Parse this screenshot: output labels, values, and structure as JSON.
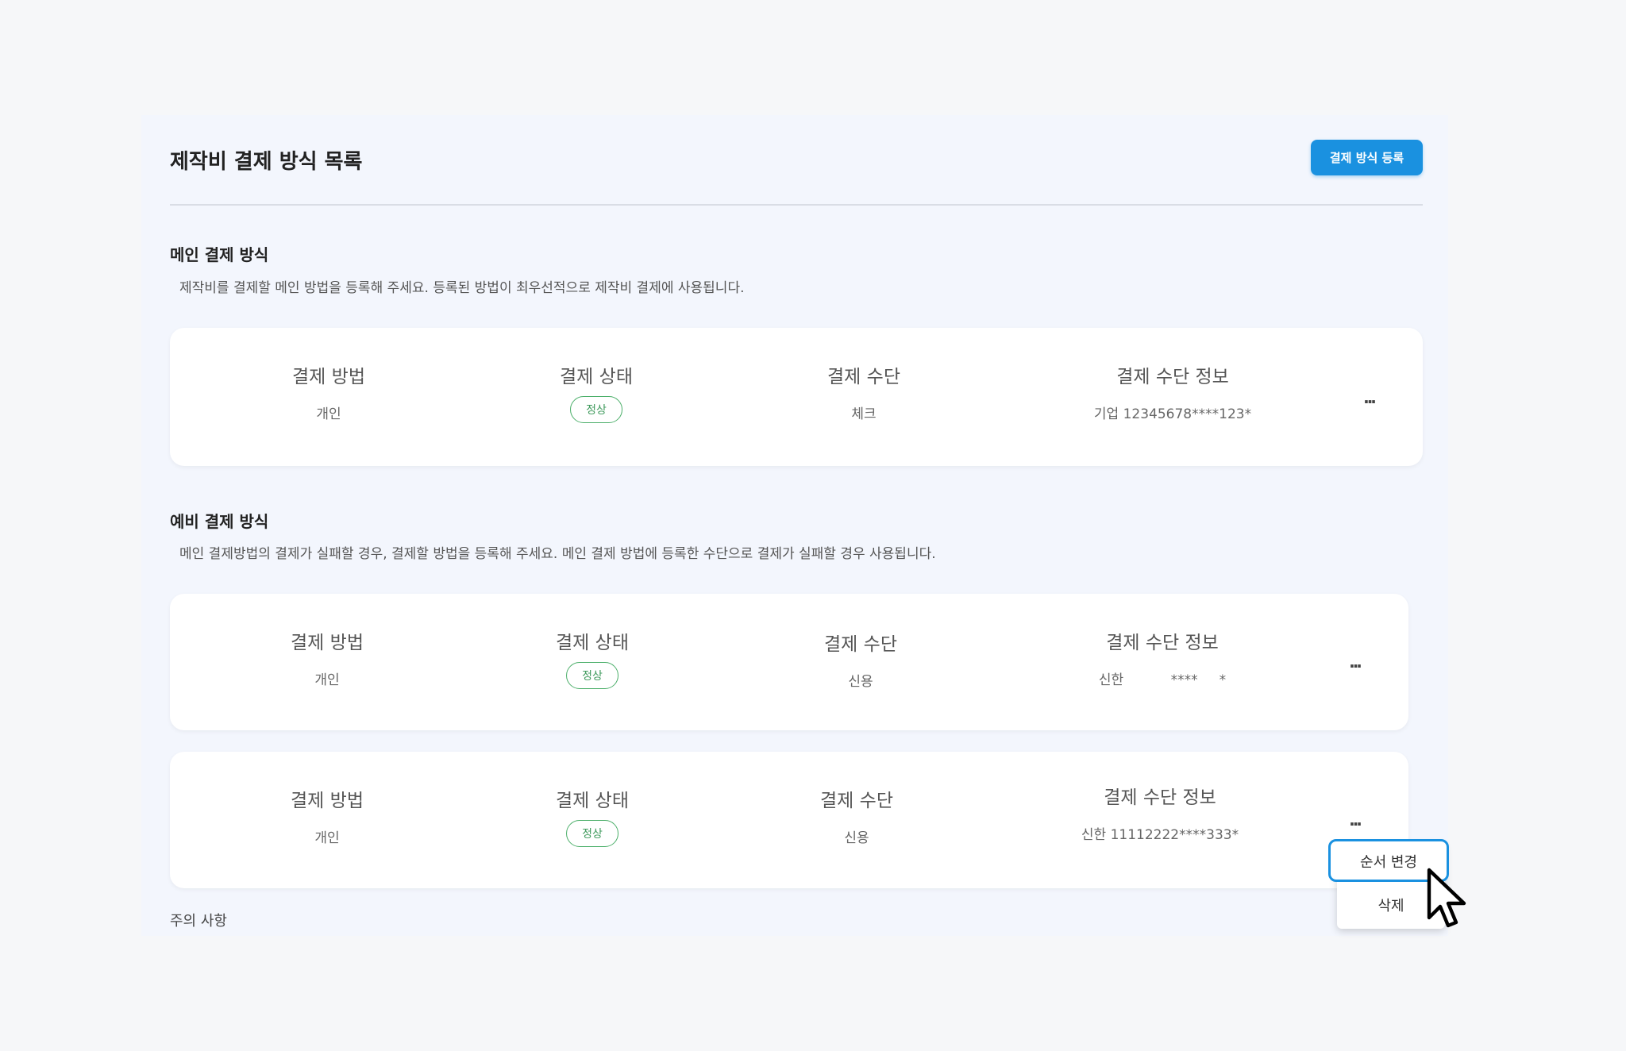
{
  "header": {
    "title": "제작비 결제 방식 목록",
    "register_button": "결제 방식 등록"
  },
  "main_section": {
    "title": "메인 결제 방식",
    "description": "제작비를 결제할 메인 방법을 등록해 주세요. 등록된 방법이 최우선적으로 제작비 결제에 사용됩니다."
  },
  "backup_section": {
    "title": "예비 결제 방식",
    "description": "메인 결제방법의 결제가 실패할 경우, 결제할 방법을 등록해 주세요. 메인 결제 방법에 등록한 수단으로 결제가 실패할 경우 사용됩니다."
  },
  "columns": {
    "method": "결제 방법",
    "status": "결제 상태",
    "instrument": "결제 수단",
    "info": "결제 수단 정보"
  },
  "cards": [
    {
      "method": "개인",
      "status": "정상",
      "instrument": "체크",
      "info": "기업 12345678****123*",
      "more": "..."
    },
    {
      "method": "개인",
      "status": "정상",
      "instrument": "신용",
      "info": "신한           ****     *",
      "more": "..."
    },
    {
      "method": "개인",
      "status": "정상",
      "instrument": "신용",
      "info": "신한 11112222****333*",
      "more": "..."
    }
  ],
  "notes": {
    "title": "주의 사항"
  },
  "context_menu": {
    "items": [
      "순서 변경",
      "삭제"
    ]
  },
  "colors": {
    "accent": "#1a91e0",
    "status_ok": "#4caf6a",
    "panel_bg": "#f3f6fd",
    "page_bg": "#f6f7f9"
  }
}
